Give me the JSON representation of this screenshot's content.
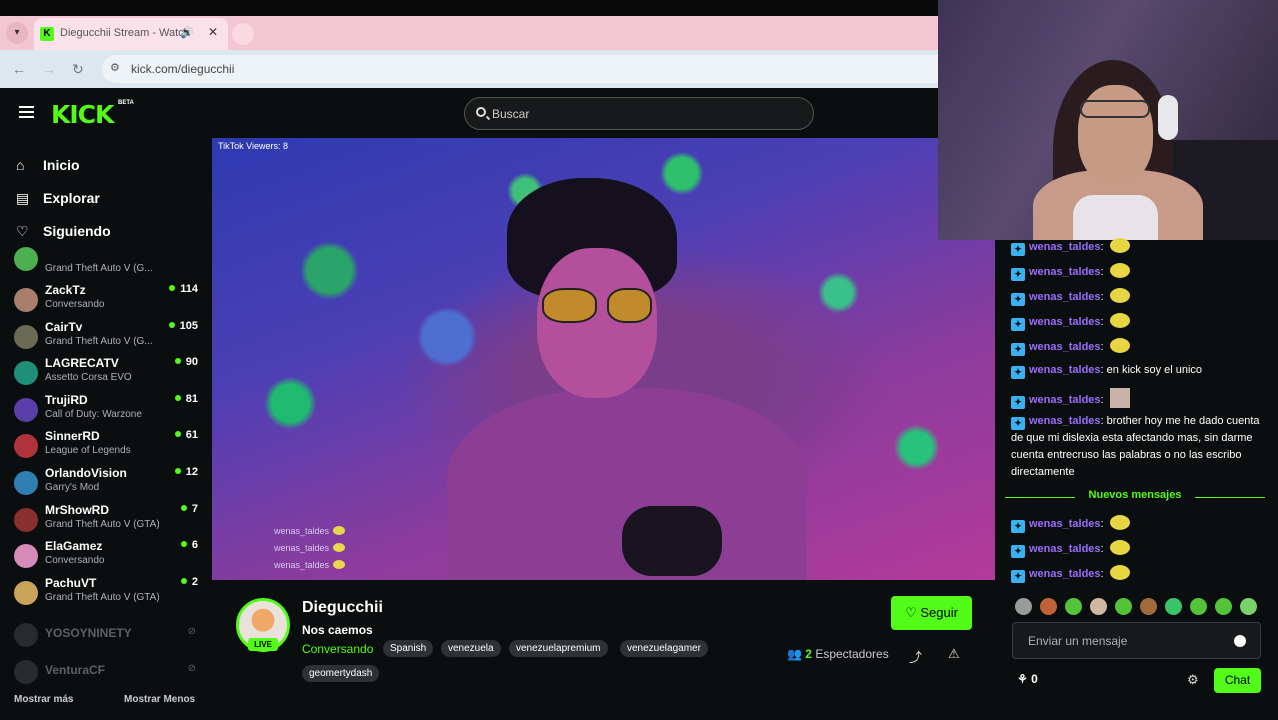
{
  "browser": {
    "tab_title": "Diegucchii Stream - Watch",
    "url": "kick.com/diegucchii"
  },
  "header": {
    "logo": "KICK",
    "beta": "BETA",
    "search_placeholder": "Buscar"
  },
  "sidebar": {
    "nav": [
      {
        "label": "Inicio"
      },
      {
        "label": "Explorar"
      },
      {
        "label": "Siguiendo"
      }
    ],
    "channels": [
      {
        "name": "",
        "category": "Grand Theft Auto V (G...",
        "viewers": "",
        "color": "#4caf50"
      },
      {
        "name": "ZackTz",
        "category": "Conversando",
        "viewers": "114",
        "color": "#a87d6b"
      },
      {
        "name": "CairTv",
        "category": "Grand Theft Auto V (G...",
        "viewers": "105",
        "color": "#6b6b55"
      },
      {
        "name": "LAGRECATV",
        "category": "Assetto Corsa EVO",
        "viewers": "90",
        "color": "#1f8f7a"
      },
      {
        "name": "TrujiRD",
        "category": "Call of Duty: Warzone",
        "viewers": "81",
        "color": "#5a3fa8"
      },
      {
        "name": "SinnerRD",
        "category": "League of Legends",
        "viewers": "61",
        "color": "#b0323a"
      },
      {
        "name": "OrlandoVision",
        "category": "Garry's Mod",
        "viewers": "12",
        "color": "#2f7fb5"
      },
      {
        "name": "MrShowRD",
        "category": "Grand Theft Auto V (GTA)",
        "viewers": "7",
        "color": "#8a2e2e"
      },
      {
        "name": "ElaGamez",
        "category": "Conversando",
        "viewers": "6",
        "color": "#d58ab8"
      },
      {
        "name": "PachuVT",
        "category": "Grand Theft Auto V (GTA)",
        "viewers": "2",
        "color": "#c9a35a"
      }
    ],
    "offline": [
      {
        "name": "YOSOYNINETY"
      },
      {
        "name": "VenturaCF"
      }
    ],
    "show_more": "Mostrar más",
    "show_less": "Mostrar Menos"
  },
  "video": {
    "tiktok_viewers": "TikTok Viewers: 8",
    "overlay_lines": [
      "wenas_taldes",
      "wenas_taldes",
      "wenas_taldes"
    ]
  },
  "stream": {
    "channel_name": "Diegucchii",
    "title": "Nos caemos",
    "category": "Conversando",
    "live": "LIVE",
    "tags": [
      "Spanish",
      "venezuela",
      "venezuelapremium",
      "venezuelagamer",
      "geomertydash"
    ],
    "follow_label": "Seguir",
    "viewer_count": "2",
    "viewer_label": "Espectadores"
  },
  "chat": {
    "messages": [
      {
        "user": "wenas_taldes",
        "text": "",
        "emote": "emote"
      },
      {
        "user": "wenas_taldes",
        "text": "",
        "emote": "emote"
      },
      {
        "user": "wenas_taldes",
        "text": "",
        "emote": "emote"
      },
      {
        "user": "wenas_taldes",
        "text": "",
        "emote": "emote"
      },
      {
        "user": "wenas_taldes",
        "text": "",
        "emote": "emote"
      },
      {
        "user": "wenas_taldes",
        "text": "en kick soy el unico",
        "emote": ""
      },
      {
        "user": "wenas_taldes",
        "text": "",
        "emote": "image"
      },
      {
        "user": "wenas_taldes",
        "text": "brother hoy me he dado cuenta de que mi dislexia esta afectando mas, sin darme cuenta entrecruso las palabras o no las escribo directamente",
        "emote": ""
      }
    ],
    "new_messages_label": "Nuevos mensajes",
    "new_messages": [
      {
        "user": "wenas_taldes",
        "text": "",
        "emote": "emote"
      },
      {
        "user": "wenas_taldes",
        "text": "",
        "emote": "emote"
      },
      {
        "user": "wenas_taldes",
        "text": "",
        "emote": "emote"
      }
    ],
    "emote_colors": [
      "#9a9a9a",
      "#c0623a",
      "#53c43a",
      "#d0b8a0",
      "#53c43a",
      "#a06a3a",
      "#3ac46a",
      "#53c43a",
      "#53c43a",
      "#7ad06a"
    ],
    "input_placeholder": "Enviar un mensaje",
    "points": "0",
    "send_label": "Chat"
  }
}
